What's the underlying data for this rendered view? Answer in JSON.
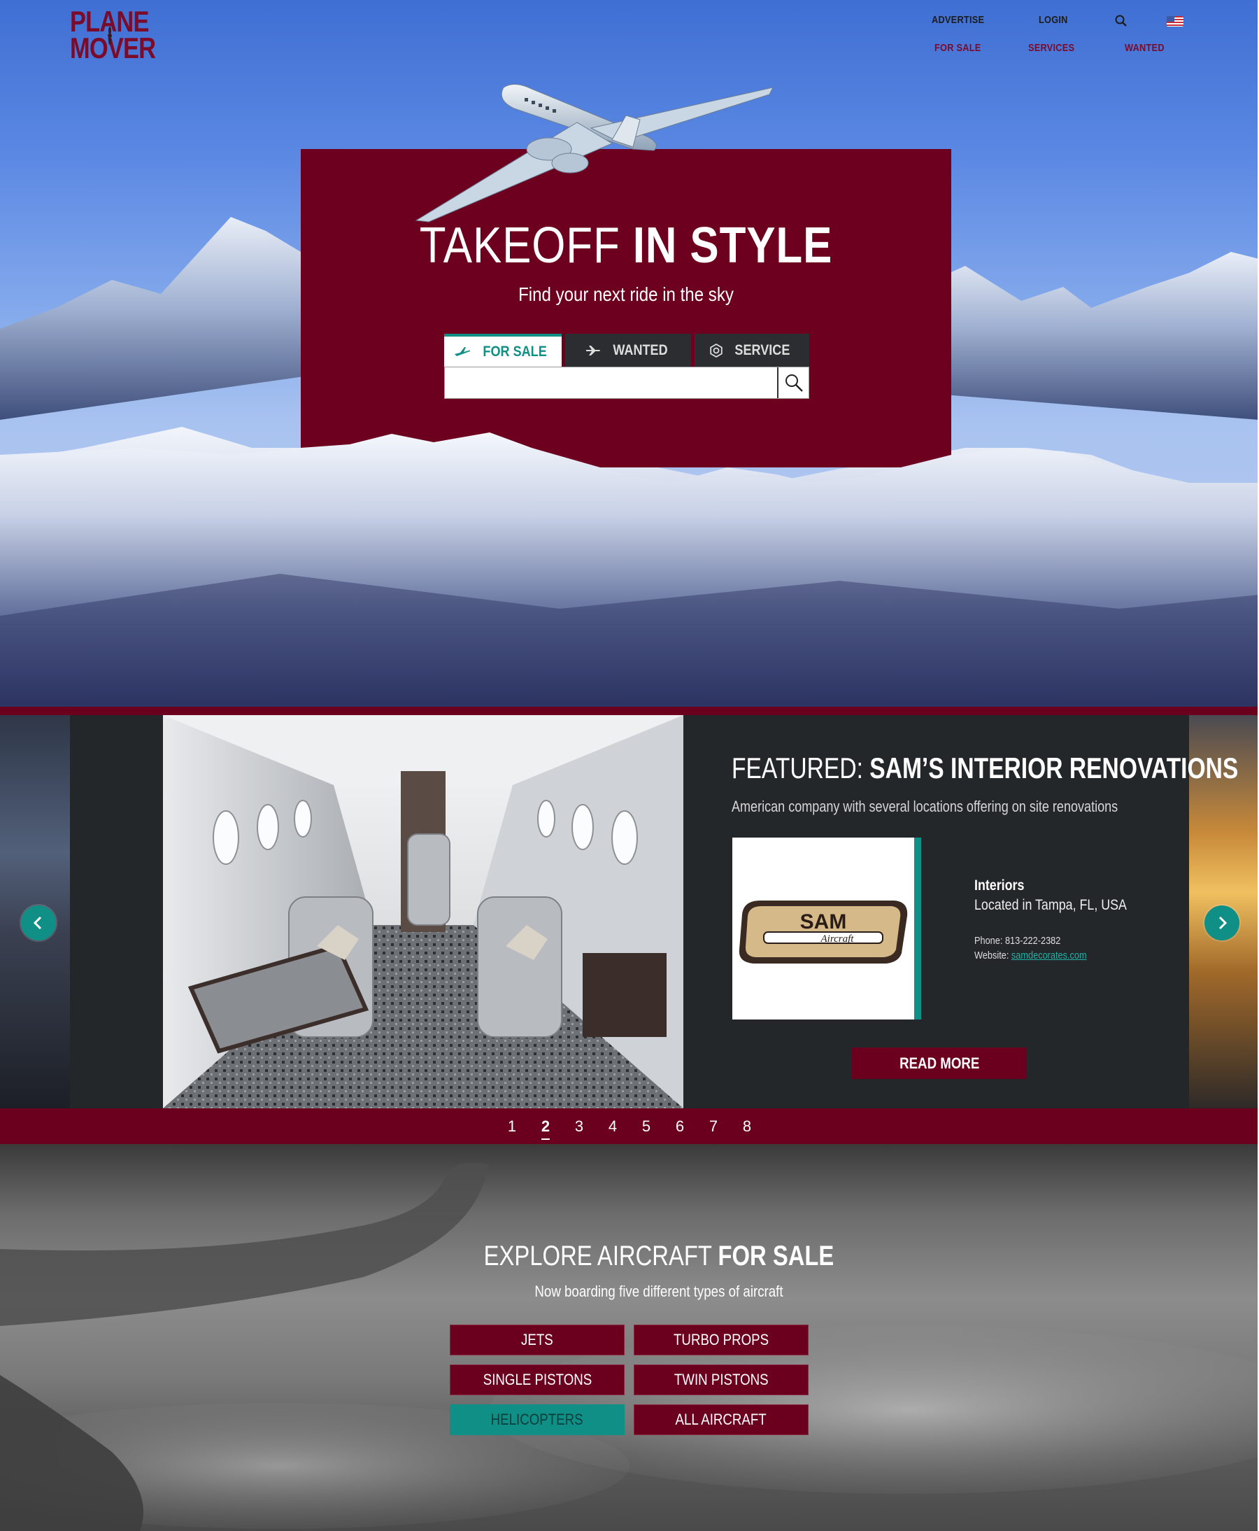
{
  "brand": {
    "line1": "PLANE",
    "line2": "MOVER",
    "color": "#7a0b2a"
  },
  "nav": {
    "top": [
      {
        "label": "ADVERTISE"
      },
      {
        "label": "LOGIN"
      }
    ],
    "bottom": [
      {
        "label": "FOR SALE"
      },
      {
        "label": "SERVICES"
      },
      {
        "label": "WANTED"
      }
    ],
    "icons": [
      "search-icon",
      "us-flag-icon"
    ]
  },
  "hero": {
    "title_thin": "TAKEOFF",
    "title_bold": "IN STYLE",
    "subtitle": "Find your next ride in the sky",
    "tabs": [
      {
        "label": "FOR SALE",
        "icon": "plane-icon",
        "active": true
      },
      {
        "label": "WANTED",
        "icon": "plane-search-icon",
        "active": false
      },
      {
        "label": "SERVICE",
        "icon": "gear-icon",
        "active": false
      }
    ],
    "search": {
      "value": "",
      "placeholder": ""
    }
  },
  "featured": {
    "title_thin": "FEATURED:",
    "title_bold": "SAM’S INTERIOR RENOVATIONS",
    "description": "American company with several locations offering on site renovations",
    "logo_text_main": "SAM",
    "logo_text_sub": "Aircraft",
    "category": "Interiors",
    "location": "Located in Tampa, FL, USA",
    "phone": "Phone: 813-222-2382",
    "website_label": "Website:",
    "website": "samdecorates.com",
    "read_more": "READ MORE",
    "pages": [
      "1",
      "2",
      "3",
      "4",
      "5",
      "6",
      "7",
      "8"
    ],
    "current_page": "2"
  },
  "explore": {
    "title_thin": "EXPLORE AIRCRAFT",
    "title_bold": "FOR SALE",
    "subtitle": "Now boarding five different types of aircraft",
    "categories": [
      {
        "label": "JETS"
      },
      {
        "label": "TURBO PROPS"
      },
      {
        "label": "SINGLE PISTONS"
      },
      {
        "label": "TWIN PISTONS"
      },
      {
        "label": "HELICOPTERS",
        "highlighted": true
      },
      {
        "label": "ALL AIRCRAFT"
      }
    ]
  },
  "colors": {
    "maroon": "#6d001f",
    "teal": "#0f8f85",
    "dark": "#24272a"
  }
}
